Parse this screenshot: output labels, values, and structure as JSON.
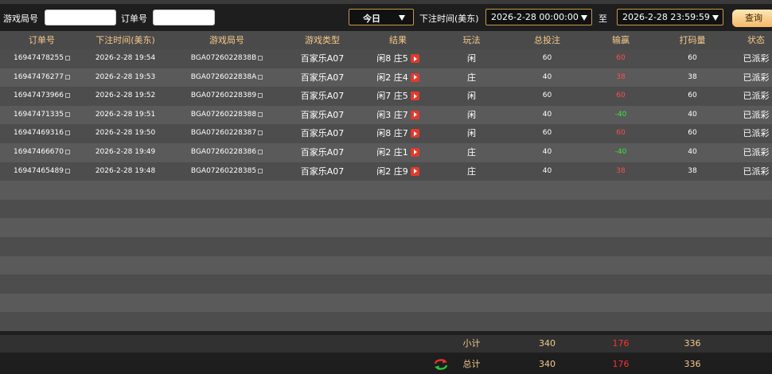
{
  "filter": {
    "game_round_label": "游戏局号",
    "game_round_value": "",
    "order_label": "订单号",
    "order_value": "",
    "period": "今日",
    "bet_time_label": "下注时间(美东)",
    "start_time": "2026-2-28 00:00:00",
    "to_label": "至",
    "end_time": "2026-2-28 23:59:59",
    "query_label": "查询"
  },
  "columns": [
    "订单号",
    "下注时间(美东)",
    "游戏局号",
    "游戏类型",
    "结果",
    "玩法",
    "总投注",
    "输赢",
    "打码量",
    "状态"
  ],
  "rows": [
    {
      "order": "16947478255",
      "time": "2026-2-28 19:54",
      "round": "BGA0726022838B",
      "type": "百家乐A07",
      "result": "闲8 庄5",
      "play": "闲",
      "bet": "60",
      "winloss": "60",
      "winloss_kind": "neg",
      "turnover": "60",
      "status": "已派彩"
    },
    {
      "order": "16947476277",
      "time": "2026-2-28 19:53",
      "round": "BGA0726022838A",
      "type": "百家乐A07",
      "result": "闲2 庄4",
      "play": "庄",
      "bet": "40",
      "winloss": "38",
      "winloss_kind": "neg",
      "turnover": "38",
      "status": "已派彩"
    },
    {
      "order": "16947473966",
      "time": "2026-2-28 19:52",
      "round": "BGA07260228389",
      "type": "百家乐A07",
      "result": "闲7 庄5",
      "play": "闲",
      "bet": "60",
      "winloss": "60",
      "winloss_kind": "neg",
      "turnover": "60",
      "status": "已派彩"
    },
    {
      "order": "16947471335",
      "time": "2026-2-28 19:51",
      "round": "BGA07260228388",
      "type": "百家乐A07",
      "result": "闲3 庄7",
      "play": "闲",
      "bet": "40",
      "winloss": "-40",
      "winloss_kind": "pos",
      "turnover": "40",
      "status": "已派彩"
    },
    {
      "order": "16947469316",
      "time": "2026-2-28 19:50",
      "round": "BGA07260228387",
      "type": "百家乐A07",
      "result": "闲8 庄7",
      "play": "闲",
      "bet": "60",
      "winloss": "60",
      "winloss_kind": "neg",
      "turnover": "60",
      "status": "已派彩"
    },
    {
      "order": "16947466670",
      "time": "2026-2-28 19:49",
      "round": "BGA07260228386",
      "type": "百家乐A07",
      "result": "闲2 庄1",
      "play": "庄",
      "bet": "40",
      "winloss": "-40",
      "winloss_kind": "pos",
      "turnover": "40",
      "status": "已派彩"
    },
    {
      "order": "16947465489",
      "time": "2026-2-28 19:48",
      "round": "BGA07260228385",
      "type": "百家乐A07",
      "result": "闲2 庄9",
      "play": "庄",
      "bet": "40",
      "winloss": "38",
      "winloss_kind": "neg",
      "turnover": "38",
      "status": "已派彩"
    }
  ],
  "empty_row_count": 8,
  "subtotal": {
    "label": "小计",
    "bet": "340",
    "winloss": "176",
    "turnover": "336"
  },
  "total": {
    "label": "总计",
    "bet": "340",
    "winloss": "176",
    "turnover": "336"
  },
  "colors": {
    "header_text": "#f6c98a",
    "loss": "#ff4d4d",
    "win": "#3ee23e",
    "accent": "#c59a4a"
  },
  "icons": {
    "copy": "copy-icon",
    "replay": "play-icon",
    "refresh": "refresh-icon",
    "dropdown": "chevron-down-icon"
  }
}
